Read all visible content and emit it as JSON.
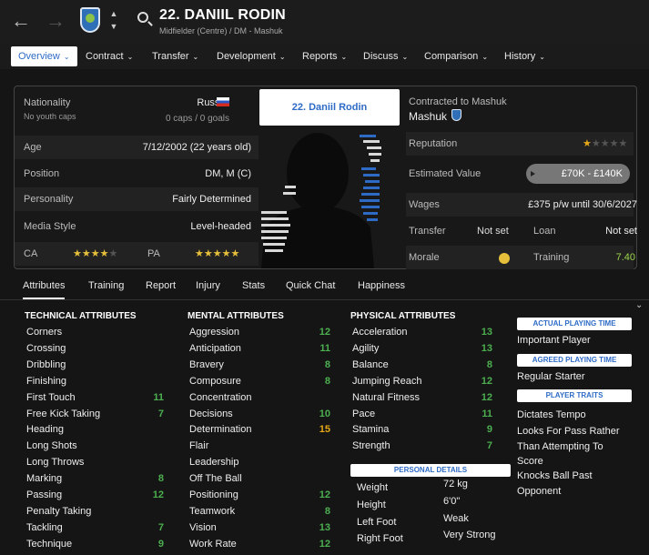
{
  "header": {
    "name": "22. DANIIL RODIN",
    "subtitle": "Midfielder (Centre) / DM - Mashuk"
  },
  "menu": [
    {
      "label": "Overview",
      "active": true
    },
    {
      "label": "Contract"
    },
    {
      "label": "Transfer"
    },
    {
      "label": "Development"
    },
    {
      "label": "Reports"
    },
    {
      "label": "Discuss"
    },
    {
      "label": "Comparison"
    },
    {
      "label": "History"
    }
  ],
  "profile": {
    "nationality_label": "Nationality",
    "nationality": "Russia",
    "youth_caps": "No youth caps",
    "caps": "0 caps / 0 goals",
    "age_label": "Age",
    "age": "7/12/2002 (22 years old)",
    "position_label": "Position",
    "position": "DM, M (C)",
    "personality_label": "Personality",
    "personality": "Fairly Determined",
    "media_label": "Media Style",
    "media": "Level-headed",
    "ca_label": "CA",
    "ca_stars": 3.5,
    "pa_label": "PA",
    "pa_stars": 5,
    "name_tag": "22. Daniil Rodin"
  },
  "contract": {
    "contracted_label": "Contracted to Mashuk",
    "club": "Mashuk",
    "reputation_label": "Reputation",
    "reputation_stars": 0.5,
    "value_label": "Estimated Value",
    "value": "£70K - £140K",
    "wages_label": "Wages",
    "wages": "£375 p/w until 30/6/2027",
    "transfer_label": "Transfer",
    "transfer": "Not set",
    "loan_label": "Loan",
    "loan": "Not set",
    "morale_label": "Morale",
    "training_label": "Training",
    "training": "7.40"
  },
  "tabs": [
    "Attributes",
    "Training",
    "Report",
    "Injury",
    "Stats",
    "Quick Chat",
    "Happiness"
  ],
  "technical": {
    "title": "TECHNICAL ATTRIBUTES",
    "items": [
      {
        "n": "Corners",
        "v": ""
      },
      {
        "n": "Crossing",
        "v": ""
      },
      {
        "n": "Dribbling",
        "v": ""
      },
      {
        "n": "Finishing",
        "v": ""
      },
      {
        "n": "First Touch",
        "v": "11"
      },
      {
        "n": "Free Kick Taking",
        "v": "7"
      },
      {
        "n": "Heading",
        "v": ""
      },
      {
        "n": "Long Shots",
        "v": ""
      },
      {
        "n": "Long Throws",
        "v": ""
      },
      {
        "n": "Marking",
        "v": "8"
      },
      {
        "n": "Passing",
        "v": "12"
      },
      {
        "n": "Penalty Taking",
        "v": ""
      },
      {
        "n": "Tackling",
        "v": "7"
      },
      {
        "n": "Technique",
        "v": "9"
      }
    ]
  },
  "mental": {
    "title": "MENTAL ATTRIBUTES",
    "items": [
      {
        "n": "Aggression",
        "v": "12"
      },
      {
        "n": "Anticipation",
        "v": "11"
      },
      {
        "n": "Bravery",
        "v": "8"
      },
      {
        "n": "Composure",
        "v": "8"
      },
      {
        "n": "Concentration",
        "v": ""
      },
      {
        "n": "Decisions",
        "v": "10"
      },
      {
        "n": "Determination",
        "v": "15"
      },
      {
        "n": "Flair",
        "v": ""
      },
      {
        "n": "Leadership",
        "v": ""
      },
      {
        "n": "Off The Ball",
        "v": ""
      },
      {
        "n": "Positioning",
        "v": "12"
      },
      {
        "n": "Teamwork",
        "v": "8"
      },
      {
        "n": "Vision",
        "v": "13"
      },
      {
        "n": "Work Rate",
        "v": "12"
      }
    ]
  },
  "physical": {
    "title": "PHYSICAL ATTRIBUTES",
    "items": [
      {
        "n": "Acceleration",
        "v": "13"
      },
      {
        "n": "Agility",
        "v": "13"
      },
      {
        "n": "Balance",
        "v": "8"
      },
      {
        "n": "Jumping Reach",
        "v": "12"
      },
      {
        "n": "Natural Fitness",
        "v": "12"
      },
      {
        "n": "Pace",
        "v": "11"
      },
      {
        "n": "Stamina",
        "v": "9"
      },
      {
        "n": "Strength",
        "v": "7"
      }
    ]
  },
  "personal": {
    "title": "PERSONAL DETAILS",
    "items": [
      {
        "n": "Weight",
        "v": "72 kg"
      },
      {
        "n": "Height",
        "v": "6'0\""
      },
      {
        "n": "Left Foot",
        "v": "Weak"
      },
      {
        "n": "Right Foot",
        "v": "Very Strong"
      }
    ]
  },
  "side": {
    "apt_title": "ACTUAL PLAYING TIME",
    "apt": "Important Player",
    "agreed_title": "AGREED PLAYING TIME",
    "agreed": "Regular Starter",
    "traits_title": "PLAYER TRAITS",
    "traits": [
      "Dictates Tempo",
      "Looks For Pass Rather Than Attempting To Score",
      "Knocks Ball Past Opponent"
    ]
  }
}
